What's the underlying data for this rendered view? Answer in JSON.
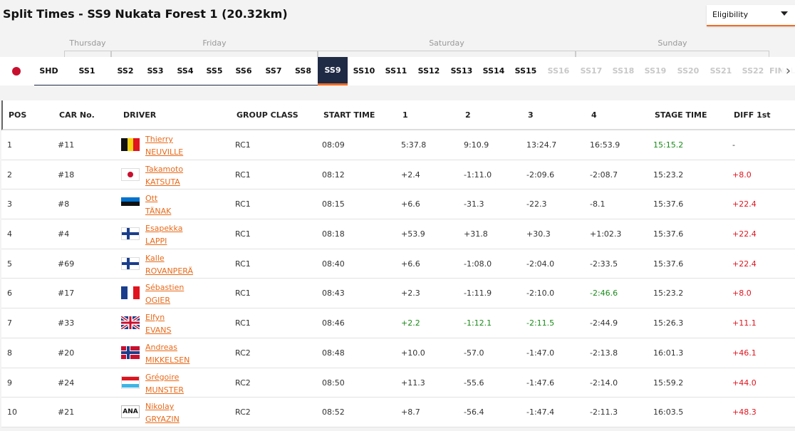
{
  "page": {
    "title": "Split Times - SS9 Nukata Forest 1 (20.32km)",
    "eligibility_label": "Eligibility"
  },
  "days": [
    "Thursday",
    "Friday",
    "Saturday",
    "Sunday"
  ],
  "stages": [
    {
      "label": "SHD",
      "state": "normal"
    },
    {
      "label": "SS1",
      "state": "normal"
    },
    {
      "label": "SS2",
      "state": "normal"
    },
    {
      "label": "SS3",
      "state": "normal"
    },
    {
      "label": "SS4",
      "state": "normal"
    },
    {
      "label": "SS5",
      "state": "normal"
    },
    {
      "label": "SS6",
      "state": "normal"
    },
    {
      "label": "SS7",
      "state": "normal"
    },
    {
      "label": "SS8",
      "state": "normal"
    },
    {
      "label": "SS9",
      "state": "active"
    },
    {
      "label": "SS10",
      "state": "normal"
    },
    {
      "label": "SS11",
      "state": "normal"
    },
    {
      "label": "SS12",
      "state": "normal"
    },
    {
      "label": "SS13",
      "state": "normal"
    },
    {
      "label": "SS14",
      "state": "normal"
    },
    {
      "label": "SS15",
      "state": "normal"
    },
    {
      "label": "SS16",
      "state": "disabled"
    },
    {
      "label": "SS17",
      "state": "disabled"
    },
    {
      "label": "SS18",
      "state": "disabled"
    },
    {
      "label": "SS19",
      "state": "disabled"
    },
    {
      "label": "SS20",
      "state": "disabled"
    },
    {
      "label": "SS21",
      "state": "disabled"
    },
    {
      "label": "SS22",
      "state": "disabled"
    },
    {
      "label": "FINAL",
      "state": "disabled"
    }
  ],
  "table": {
    "headers": [
      "POS",
      "CAR No.",
      "DRIVER",
      "GROUP CLASS",
      "START TIME",
      "1",
      "2",
      "3",
      "4",
      "STAGE TIME",
      "DIFF 1st"
    ],
    "rows": [
      {
        "pos": "1",
        "car": "#11",
        "flag": "BEL",
        "first": "Thierry",
        "last": "NEUVILLE",
        "cls": "RC1",
        "start": "08:09",
        "s1": "5:37.8",
        "s2": "9:10.9",
        "s3": "13:24.7",
        "s4": "16:53.9",
        "stage": "15:15.2",
        "diff": "-"
      },
      {
        "pos": "2",
        "car": "#18",
        "flag": "JPN",
        "first": "Takamoto",
        "last": "KATSUTA",
        "cls": "RC1",
        "start": "08:12",
        "s1": "+2.4",
        "s2": "-1:11.0",
        "s3": "-2:09.6",
        "s4": "-2:08.7",
        "stage": "15:23.2",
        "diff": "+8.0"
      },
      {
        "pos": "3",
        "car": "#8",
        "flag": "EST",
        "first": "Ott",
        "last": "TÄNAK",
        "cls": "RC1",
        "start": "08:15",
        "s1": "+6.6",
        "s2": "-31.3",
        "s3": "-22.3",
        "s4": "-8.1",
        "stage": "15:37.6",
        "diff": "+22.4"
      },
      {
        "pos": "4",
        "car": "#4",
        "flag": "FIN",
        "first": "Esapekka",
        "last": "LAPPI",
        "cls": "RC1",
        "start": "08:18",
        "s1": "+53.9",
        "s2": "+31.8",
        "s3": "+30.3",
        "s4": "+1:02.3",
        "stage": "15:37.6",
        "diff": "+22.4"
      },
      {
        "pos": "5",
        "car": "#69",
        "flag": "FIN",
        "first": "Kalle",
        "last": "ROVANPERÄ",
        "cls": "RC1",
        "start": "08:40",
        "s1": "+6.6",
        "s2": "-1:08.0",
        "s3": "-2:04.0",
        "s4": "-2:33.5",
        "stage": "15:37.6",
        "diff": "+22.4"
      },
      {
        "pos": "6",
        "car": "#17",
        "flag": "FRA",
        "first": "Sébastien",
        "last": "OGIER",
        "cls": "RC1",
        "start": "08:43",
        "s1": "+2.3",
        "s2": "-1:11.9",
        "s3": "-2:10.0",
        "s4": "-2:46.6",
        "stage": "15:23.2",
        "diff": "+8.0"
      },
      {
        "pos": "7",
        "car": "#33",
        "flag": "GBR",
        "first": "Elfyn",
        "last": "EVANS",
        "cls": "RC1",
        "start": "08:46",
        "s1": "+2.2",
        "s2": "-1:12.1",
        "s3": "-2:11.5",
        "s4": "-2:44.9",
        "stage": "15:26.3",
        "diff": "+11.1"
      },
      {
        "pos": "8",
        "car": "#20",
        "flag": "NOR",
        "first": "Andreas",
        "last": "MIKKELSEN",
        "cls": "RC2",
        "start": "08:48",
        "s1": "+10.0",
        "s2": "-57.0",
        "s3": "-1:47.0",
        "s4": "-2:13.8",
        "stage": "16:01.3",
        "diff": "+46.1"
      },
      {
        "pos": "9",
        "car": "#24",
        "flag": "LUX",
        "first": "Grégoire",
        "last": "MUNSTER",
        "cls": "RC2",
        "start": "08:50",
        "s1": "+11.3",
        "s2": "-55.6",
        "s3": "-1:47.6",
        "s4": "-2:14.0",
        "stage": "15:59.2",
        "diff": "+44.0"
      },
      {
        "pos": "10",
        "car": "#21",
        "flag": "ANA",
        "first": "Nikolay",
        "last": "GRYAZIN",
        "cls": "RC2",
        "start": "08:52",
        "s1": "+8.7",
        "s2": "-56.4",
        "s3": "-1:47.4",
        "s4": "-2:11.3",
        "stage": "16:03.5",
        "diff": "+48.3"
      }
    ],
    "highlights": {
      "6": [
        "s4"
      ],
      "7": [
        "s1",
        "s2",
        "s3"
      ]
    }
  },
  "colors": {
    "accent": "#f26c24",
    "active_bg": "#1f2a44",
    "fastest": "#1a8a1a",
    "diff": "#e0141e",
    "link": "#e86a1a"
  }
}
